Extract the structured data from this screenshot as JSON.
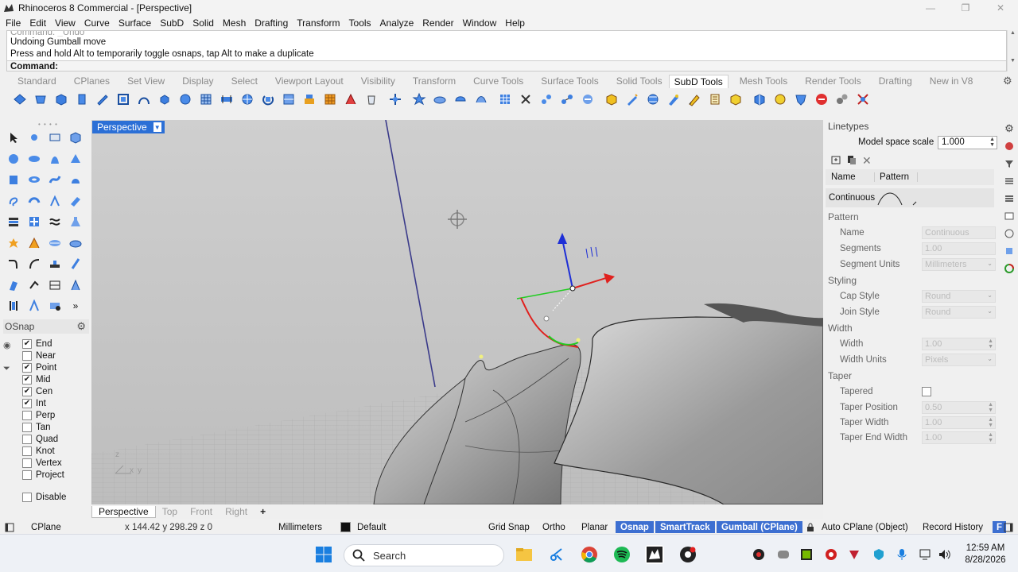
{
  "window": {
    "title": "Rhinoceros 8 Commercial - [Perspective]",
    "controls": [
      "—",
      "❐",
      "✕"
    ]
  },
  "menu": [
    "File",
    "Edit",
    "View",
    "Curve",
    "Surface",
    "SubD",
    "Solid",
    "Mesh",
    "Drafting",
    "Transform",
    "Tools",
    "Analyze",
    "Render",
    "Window",
    "Help"
  ],
  "command": {
    "history_faded": "Command: _Undo",
    "line1": "Undoing Gumball move",
    "line2": "Press and hold Alt to temporarily toggle osnaps, tap Alt to make a duplicate",
    "prompt": "Command:"
  },
  "toolbar_tabs": [
    "Standard",
    "CPlanes",
    "Set View",
    "Display",
    "Select",
    "Viewport Layout",
    "Visibility",
    "Transform",
    "Curve Tools",
    "Surface Tools",
    "Solid Tools",
    "SubD Tools",
    "Mesh Tools",
    "Render Tools",
    "Drafting",
    "New in V8"
  ],
  "active_toolbar_tab": "SubD Tools",
  "osnap": {
    "header": "OSnap",
    "items": [
      {
        "label": "End",
        "checked": true
      },
      {
        "label": "Near",
        "checked": false
      },
      {
        "label": "Point",
        "checked": true
      },
      {
        "label": "Mid",
        "checked": true
      },
      {
        "label": "Cen",
        "checked": true
      },
      {
        "label": "Int",
        "checked": true
      },
      {
        "label": "Perp",
        "checked": false
      },
      {
        "label": "Tan",
        "checked": false
      },
      {
        "label": "Quad",
        "checked": false
      },
      {
        "label": "Knot",
        "checked": false
      },
      {
        "label": "Vertex",
        "checked": false
      },
      {
        "label": "Project",
        "checked": false
      }
    ],
    "disable_label": "Disable"
  },
  "viewport": {
    "label": "Perspective",
    "axis_z": "z",
    "axis_x": "x",
    "axis_y": "y",
    "tabs": [
      "Perspective",
      "Top",
      "Front",
      "Right"
    ],
    "add_tab": "+"
  },
  "linetypes_panel": {
    "title": "Linetypes",
    "model_space_scale_label": "Model space scale",
    "model_space_scale_value": "1.000",
    "col_name": "Name",
    "col_pattern": "Pattern",
    "selected_row": "Continuous",
    "pattern_section": "Pattern",
    "name_label": "Name",
    "name_value": "Continuous",
    "segments_label": "Segments",
    "segments_value": "1.00",
    "segment_units_label": "Segment Units",
    "segment_units_value": "Millimeters",
    "styling_section": "Styling",
    "cap_style_label": "Cap Style",
    "cap_style_value": "Round",
    "join_style_label": "Join Style",
    "join_style_value": "Round",
    "width_section": "Width",
    "width_label": "Width",
    "width_value": "1.00",
    "width_units_label": "Width Units",
    "width_units_value": "Pixels",
    "taper_section": "Taper",
    "tapered_label": "Tapered",
    "taper_position_label": "Taper Position",
    "taper_position_value": "0.50",
    "taper_width_label": "Taper Width",
    "taper_width_value": "1.00",
    "taper_end_width_label": "Taper End Width",
    "taper_end_width_value": "1.00"
  },
  "statusbar": {
    "cplane": "CPlane",
    "coords": "x 144.42   y 298.29   z 0",
    "units": "Millimeters",
    "layer": "Default",
    "grid_snap": "Grid Snap",
    "ortho": "Ortho",
    "planar": "Planar",
    "osnap": "Osnap",
    "smarttrack": "SmartTrack",
    "gumball": "Gumball (CPlane)",
    "auto_cplane": "Auto CPlane (Object)",
    "record_history": "Record History",
    "filter": "F"
  },
  "taskbar": {
    "search_placeholder": "Search",
    "time": "12:59 AM",
    "date": "8/28/2026"
  },
  "colors": {
    "accent_blue": "#3d6fd1",
    "viewport_bg": "#c7c7c7",
    "gumball_x": "#e0211e",
    "gumball_y": "#22cc22",
    "gumball_z": "#1e2fd6"
  }
}
